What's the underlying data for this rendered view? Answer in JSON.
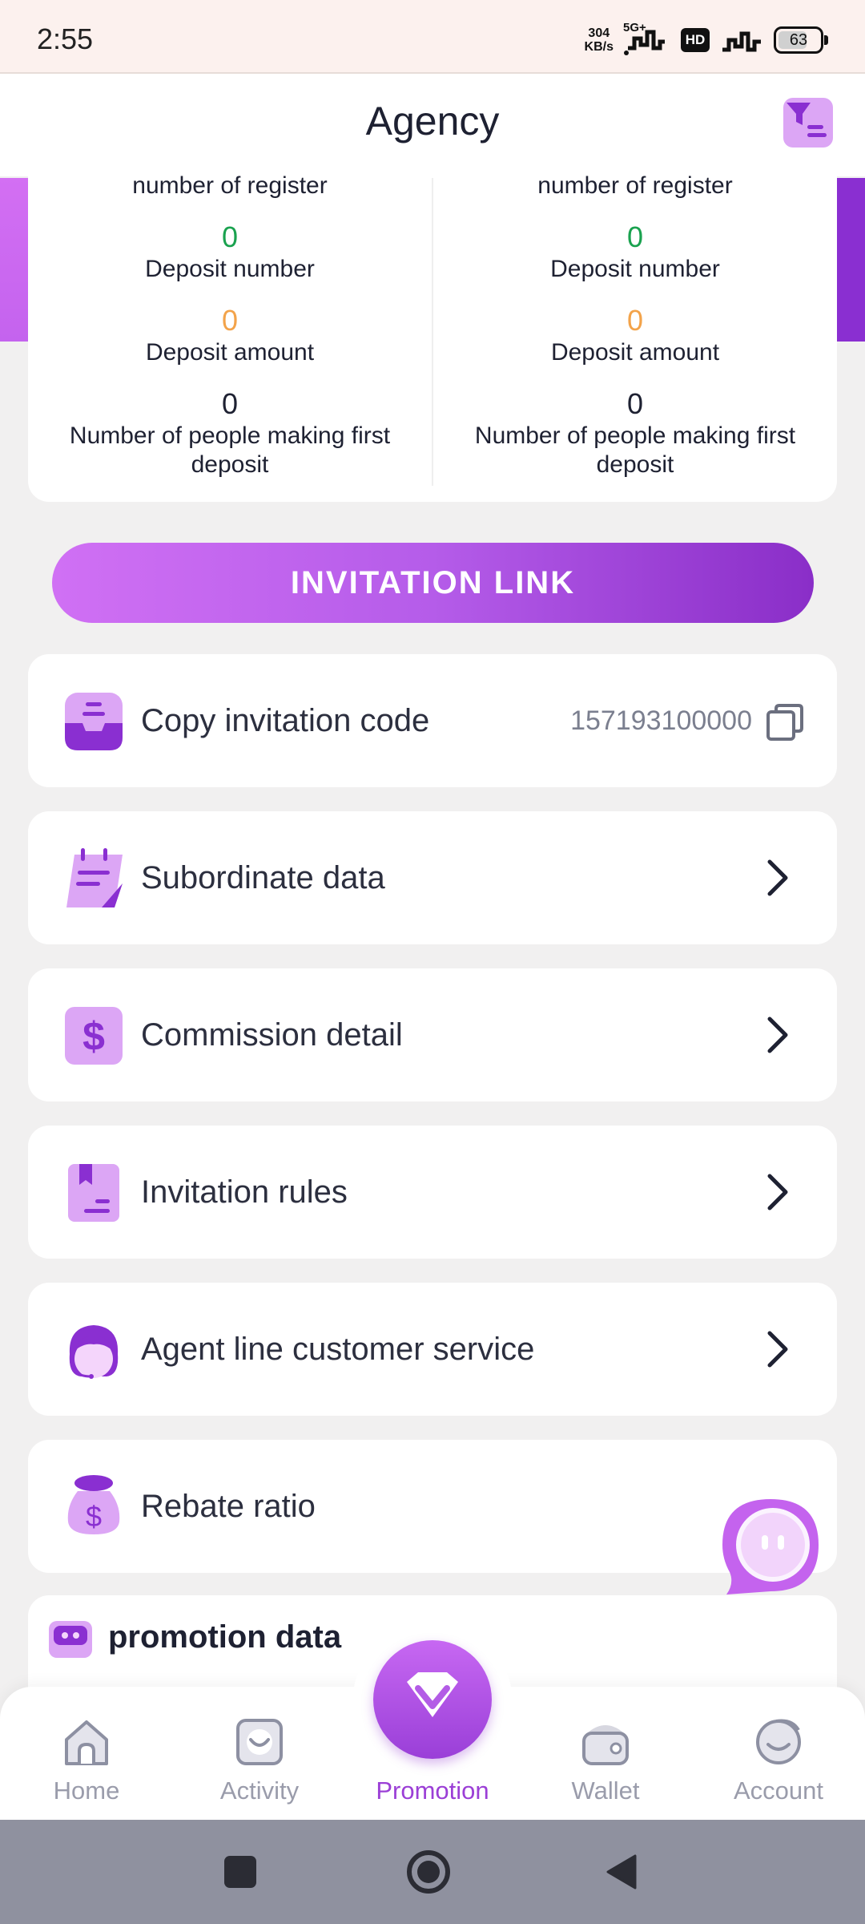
{
  "status_bar": {
    "time": "2:55",
    "speed_value": "304",
    "speed_unit": "KB/s",
    "network": "5G+",
    "hd": "HD",
    "battery": "63"
  },
  "header": {
    "title": "Agency",
    "filter_icon": "filter-list-icon"
  },
  "stats": {
    "left": {
      "register_label": "number of register",
      "deposit_number_value": "0",
      "deposit_number_label": "Deposit number",
      "deposit_amount_value": "0",
      "deposit_amount_label": "Deposit amount",
      "first_deposit_value": "0",
      "first_deposit_label": "Number of people making first deposit"
    },
    "right": {
      "register_label": "number of register",
      "deposit_number_value": "0",
      "deposit_number_label": "Deposit number",
      "deposit_amount_value": "0",
      "deposit_amount_label": "Deposit amount",
      "first_deposit_value": "0",
      "first_deposit_label": "Number of people making first deposit"
    }
  },
  "invite_button": {
    "label": "INVITATION LINK"
  },
  "menu": {
    "copy_code": {
      "label": "Copy invitation code",
      "value": "157193100000",
      "icon": "inbox-tray-icon"
    },
    "subordinate": {
      "label": "Subordinate data",
      "icon": "calendar-notepad-icon"
    },
    "commission": {
      "label": "Commission detail",
      "icon": "dollar-icon"
    },
    "rules": {
      "label": "Invitation rules",
      "icon": "bookmark-document-icon"
    },
    "customer_service": {
      "label": "Agent line customer service",
      "icon": "headset-agent-icon"
    },
    "rebate": {
      "label": "Rebate ratio",
      "icon": "money-bag-icon"
    }
  },
  "promotion_data": {
    "title": "promotion data"
  },
  "bottom_nav": {
    "home": "Home",
    "activity": "Activity",
    "promotion": "Promotion",
    "wallet": "Wallet",
    "account": "Account"
  },
  "colors": {
    "accent": "#9b3fd6",
    "icon_light": "#dca6f5",
    "icon_dark": "#8a2fd1",
    "green": "#1aa24f",
    "orange": "#f3a34a"
  }
}
